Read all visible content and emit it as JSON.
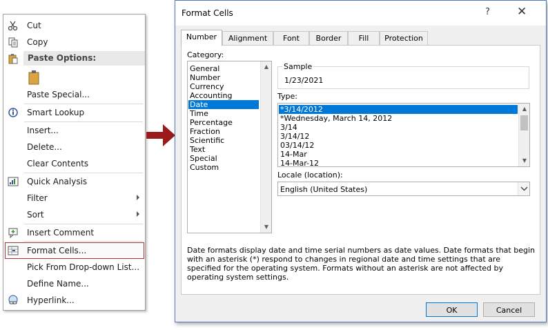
{
  "context_menu": {
    "items": [
      {
        "label": "Cut",
        "icon": "scissors-icon"
      },
      {
        "label": "Copy",
        "icon": "copy-icon"
      },
      {
        "label": "Paste Options:",
        "icon": "paste-icon"
      },
      {
        "label": "Paste Special...",
        "icon": ""
      },
      {
        "label": "Smart Lookup",
        "icon": "smart-lookup-icon"
      },
      {
        "label": "Insert...",
        "icon": ""
      },
      {
        "label": "Delete...",
        "icon": ""
      },
      {
        "label": "Clear Contents",
        "icon": ""
      },
      {
        "label": "Quick Analysis",
        "icon": "quick-analysis-icon"
      },
      {
        "label": "Filter",
        "icon": ""
      },
      {
        "label": "Sort",
        "icon": ""
      },
      {
        "label": "Insert Comment",
        "icon": "insert-comment-icon"
      },
      {
        "label": "Format Cells...",
        "icon": "format-cells-icon"
      },
      {
        "label": "Pick From Drop-down List...",
        "icon": ""
      },
      {
        "label": "Define Name...",
        "icon": ""
      },
      {
        "label": "Hyperlink...",
        "icon": "hyperlink-icon"
      }
    ]
  },
  "dialog": {
    "title": "Format Cells",
    "help": "?",
    "close": "✕",
    "tabs": [
      "Number",
      "Alignment",
      "Font",
      "Border",
      "Fill",
      "Protection"
    ],
    "category_label": "Category:",
    "categories": [
      "General",
      "Number",
      "Currency",
      "Accounting",
      "Date",
      "Time",
      "Percentage",
      "Fraction",
      "Scientific",
      "Text",
      "Special",
      "Custom"
    ],
    "selected_category": "Date",
    "sample_label": "Sample",
    "sample_value": "1/23/2021",
    "type_label": "Type:",
    "types": [
      "*3/14/2012",
      "*Wednesday, March 14, 2012",
      "3/14",
      "3/14/12",
      "03/14/12",
      "14-Mar",
      "14-Mar-12"
    ],
    "selected_type": "*3/14/2012",
    "locale_label": "Locale (location):",
    "locale_value": "English (United States)",
    "description": "Date formats display date and time serial numbers as date values.  Date formats that begin with an asterisk (*) respond to changes in regional date and time settings that are specified for the operating system. Formats without an asterisk are not affected by operating system settings.",
    "ok_label": "OK",
    "cancel_label": "Cancel"
  },
  "colors": {
    "selection": "#0078d7",
    "highlight_border": "#b03030",
    "arrow": "#9b1b1b"
  }
}
